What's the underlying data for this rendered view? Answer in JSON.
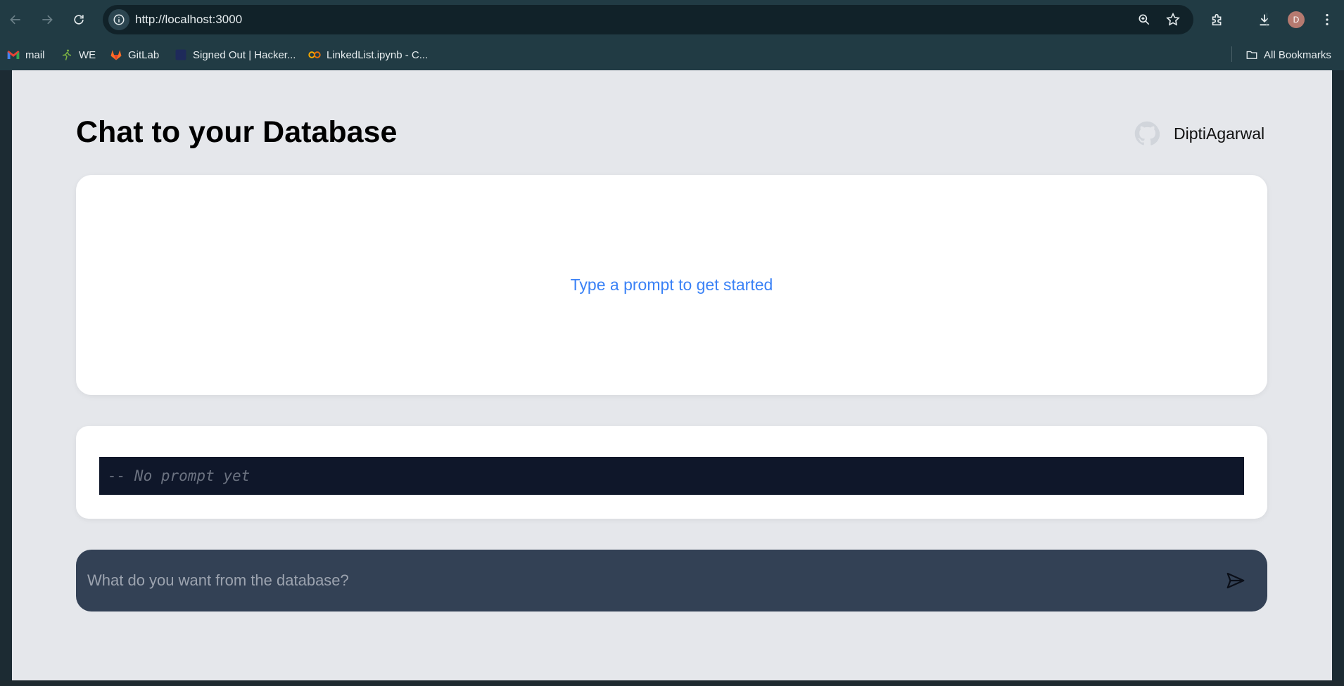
{
  "browser": {
    "url": "http://localhost:3000",
    "avatar_letter": "D",
    "bookmarks": [
      {
        "label": "mail",
        "icon": "gmail-icon"
      },
      {
        "label": "WE",
        "icon": "runner-icon"
      },
      {
        "label": "GitLab",
        "icon": "gitlab-icon"
      },
      {
        "label": "Signed Out | Hacker...",
        "icon": "hackerrank-icon"
      },
      {
        "label": "LinkedList.ipynb - C...",
        "icon": "colab-icon"
      }
    ],
    "all_bookmarks_label": "All Bookmarks"
  },
  "page": {
    "title": "Chat to your Database",
    "github_user": "DiptiAgarwal",
    "results_hint": "Type a prompt to get started",
    "sql_placeholder": "-- No prompt yet",
    "prompt_placeholder": "What do you want from the database?"
  },
  "colors": {
    "accent": "#3b82f6",
    "page_bg": "#e5e7eb",
    "code_bg": "#0f172a",
    "prompt_bg": "#334155"
  }
}
